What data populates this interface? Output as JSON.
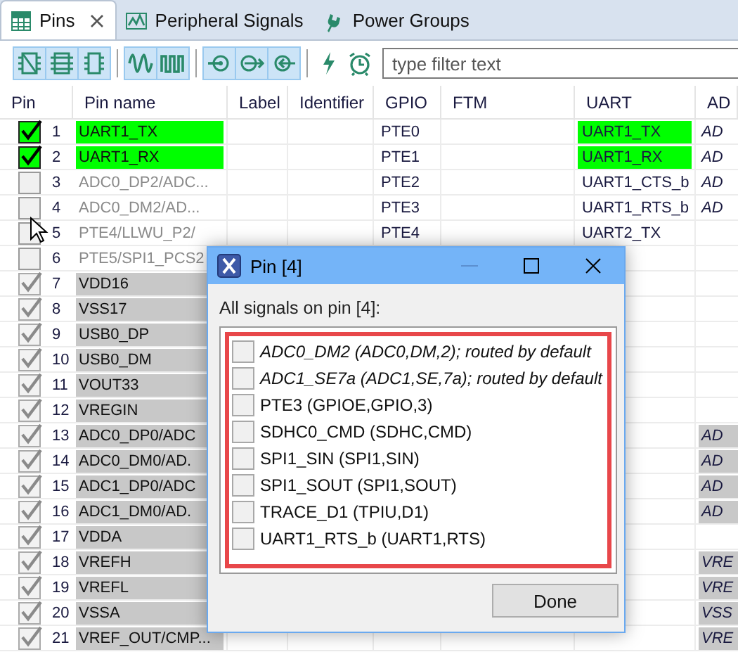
{
  "tabs": [
    {
      "label": "Pins",
      "closable": true,
      "selected": true
    },
    {
      "label": "Peripheral Signals",
      "closable": false,
      "selected": false
    },
    {
      "label": "Power Groups",
      "closable": false,
      "selected": false
    }
  ],
  "toolbar": {
    "filter": {
      "placeholder": "type filter text"
    }
  },
  "table": {
    "columns": [
      "Pin",
      "Pin name",
      "Label",
      "Identifier",
      "GPIO",
      "FTM",
      "UART",
      "AD"
    ],
    "rows": [
      {
        "kind": "routed",
        "checked": true,
        "pin": "1",
        "name": "UART1_TX",
        "gpio": "PTE0",
        "uart": "UART1_TX",
        "adc": {
          "text": "AD",
          "shaded": false
        }
      },
      {
        "kind": "routed",
        "checked": true,
        "pin": "2",
        "name": "UART1_RX",
        "gpio": "PTE1",
        "uart": "UART1_RX",
        "adc": {
          "text": "AD",
          "shaded": false
        }
      },
      {
        "kind": "free",
        "checked": false,
        "pin": "3",
        "name": "ADC0_DP2/ADC...",
        "gpio": "PTE2",
        "uart": "UART1_CTS_b",
        "adc": {
          "text": "AD",
          "shaded": false
        }
      },
      {
        "kind": "free",
        "checked": false,
        "pin": "4",
        "name": "ADC0_DM2/AD...",
        "gpio": "PTE3",
        "uart": "UART1_RTS_b",
        "adc": {
          "text": "AD",
          "shaded": false
        }
      },
      {
        "kind": "free",
        "checked": false,
        "pin": "5",
        "name": "PTE4/LLWU_P2/",
        "gpio": "PTE4",
        "uart": "UART2_TX"
      },
      {
        "kind": "free",
        "checked": false,
        "pin": "6",
        "name": "PTE5/SPI1_PCS2"
      },
      {
        "kind": "fixed",
        "checked": true,
        "pin": "7",
        "name": "VDD16"
      },
      {
        "kind": "fixed",
        "checked": true,
        "pin": "8",
        "name": "VSS17"
      },
      {
        "kind": "fixed",
        "checked": true,
        "pin": "9",
        "name": "USB0_DP"
      },
      {
        "kind": "fixed",
        "checked": true,
        "pin": "10",
        "name": "USB0_DM"
      },
      {
        "kind": "fixed",
        "checked": true,
        "pin": "11",
        "name": "VOUT33"
      },
      {
        "kind": "fixed",
        "checked": true,
        "pin": "12",
        "name": "VREGIN"
      },
      {
        "kind": "fixed",
        "checked": true,
        "pin": "13",
        "name": "ADC0_DP0/ADC",
        "adc": {
          "text": "AD",
          "shaded": true
        }
      },
      {
        "kind": "fixed",
        "checked": true,
        "pin": "14",
        "name": "ADC0_DM0/AD.",
        "adc": {
          "text": "AD",
          "shaded": true
        }
      },
      {
        "kind": "fixed",
        "checked": true,
        "pin": "15",
        "name": "ADC1_DP0/ADC",
        "adc": {
          "text": "AD",
          "shaded": true
        }
      },
      {
        "kind": "fixed",
        "checked": true,
        "pin": "16",
        "name": "ADC1_DM0/AD.",
        "adc": {
          "text": "AD",
          "shaded": true
        }
      },
      {
        "kind": "fixed",
        "checked": true,
        "pin": "17",
        "name": "VDDA"
      },
      {
        "kind": "fixed",
        "checked": true,
        "pin": "18",
        "name": "VREFH",
        "adc": {
          "text": "VRE",
          "shaded": true
        }
      },
      {
        "kind": "fixed",
        "checked": true,
        "pin": "19",
        "name": "VREFL",
        "adc": {
          "text": "VRE",
          "shaded": true
        }
      },
      {
        "kind": "fixed",
        "checked": true,
        "pin": "20",
        "name": "VSSA",
        "adc": {
          "text": "VSS",
          "shaded": true
        }
      },
      {
        "kind": "fixed",
        "checked": true,
        "pin": "21",
        "name": "VREF_OUT/CMP...",
        "adc": {
          "text": "VRE",
          "shaded": true
        }
      }
    ]
  },
  "dialog": {
    "title": "Pin [4]",
    "label": "All signals on pin [4]:",
    "signals": [
      {
        "text": "ADC0_DM2 (ADC0,DM,2); routed by default",
        "default": true,
        "checked": false
      },
      {
        "text": "ADC1_SE7a (ADC1,SE,7a); routed by default",
        "default": true,
        "checked": false
      },
      {
        "text": "PTE3 (GPIOE,GPIO,3)",
        "default": false,
        "checked": false
      },
      {
        "text": "SDHC0_CMD (SDHC,CMD)",
        "default": false,
        "checked": false
      },
      {
        "text": "SPI1_SIN (SPI1,SIN)",
        "default": false,
        "checked": false
      },
      {
        "text": "SPI1_SOUT (SPI1,SOUT)",
        "default": false,
        "checked": false
      },
      {
        "text": "TRACE_D1 (TPIU,D1)",
        "default": false,
        "checked": false
      },
      {
        "text": "UART1_RTS_b (UART1,RTS)",
        "default": false,
        "checked": false
      }
    ],
    "button": "Done"
  }
}
